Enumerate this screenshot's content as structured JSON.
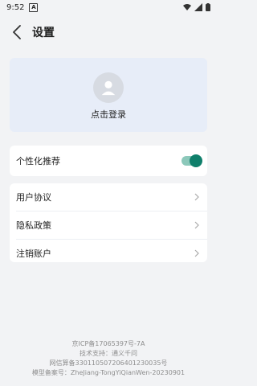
{
  "status": {
    "time": "9:52"
  },
  "header": {
    "title": "设置"
  },
  "login": {
    "label": "点击登录"
  },
  "recommend": {
    "label": "个性化推荐",
    "enabled": true,
    "accent": "#0f7f6b"
  },
  "menu": [
    {
      "label": "用户协议"
    },
    {
      "label": "隐私政策"
    },
    {
      "label": "注销账户"
    }
  ],
  "footer": {
    "line1": "京ICP备17065397号-7A",
    "line2": "技术支持：通义千问",
    "line3": "网信算备330110507206401230035号",
    "line4": "模型备案号：ZheJiang-TongYiQianWen-20230901"
  }
}
